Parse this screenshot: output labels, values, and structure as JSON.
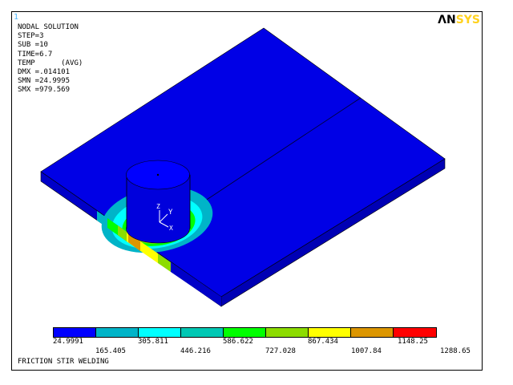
{
  "window": {
    "number": "1",
    "logo_part1": "ΛN",
    "logo_part2": "SYS"
  },
  "info": {
    "lines": [
      "NODAL SOLUTION",
      "",
      "STEP=3",
      "SUB =10",
      "TIME=6.7",
      "TEMP      (AVG)",
      "DMX =.014101",
      "SMN =24.9995",
      "SMX =979.569"
    ]
  },
  "triad": {
    "z_label": "Z",
    "y_label": "Y",
    "x_label": "X"
  },
  "legend": {
    "colors": [
      "#0000ff",
      "#00b4c8",
      "#00ffff",
      "#00c8b4",
      "#00ff00",
      "#8cdc00",
      "#ffff00",
      "#dc9600",
      "#ff0000"
    ],
    "labels_top": [
      "24.9991",
      "305.811",
      "586.622",
      "867.434",
      "1148.25"
    ],
    "labels_bottom": [
      "165.405",
      "446.216",
      "727.028",
      "1007.84",
      "1288.65"
    ]
  },
  "footer": {
    "title": "FRICTION STIR WELDING"
  }
}
